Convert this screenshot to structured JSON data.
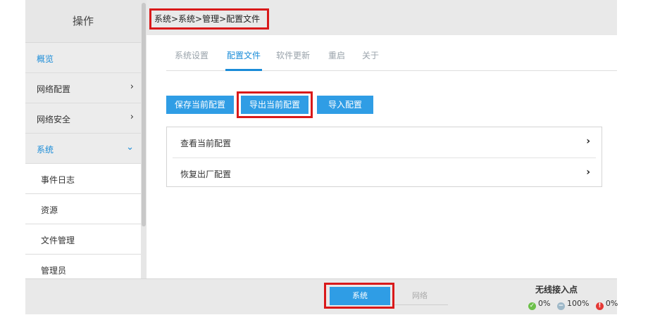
{
  "sidebar": {
    "title": "操作",
    "items": [
      {
        "label": "概览"
      },
      {
        "label": "网络配置",
        "chevron": "›"
      },
      {
        "label": "网络安全",
        "chevron": "›"
      },
      {
        "label": "系统",
        "chevron": "⌄"
      },
      {
        "label": "事件日志"
      },
      {
        "label": "资源"
      },
      {
        "label": "文件管理"
      },
      {
        "label": "管理员"
      }
    ]
  },
  "breadcrumb": "系统>系统>管理>配置文件",
  "tabs": [
    "系统设置",
    "配置文件",
    "软件更新",
    "重启",
    "关于"
  ],
  "buttons": {
    "save": "保存当前配置",
    "export": "导出当前配置",
    "import": "导入配置"
  },
  "panel": {
    "rows": [
      {
        "label": "查看当前配置"
      },
      {
        "label": "恢复出厂配置"
      }
    ],
    "chevron": "›"
  },
  "footer": {
    "segment_system": "系统",
    "segment_network": "网络",
    "ap_title": "无线接入点",
    "stats": [
      {
        "value": "0%",
        "color": "#6cc04a",
        "icon": "check-icon"
      },
      {
        "value": "100%",
        "color": "#9eb8c8",
        "icon": "minus-icon"
      },
      {
        "value": "0%",
        "color": "#e53935",
        "icon": "alert-icon"
      }
    ]
  },
  "colors": {
    "accent": "#2f9de5",
    "highlight": "#d9191a",
    "active_text": "#1a8cd8"
  }
}
